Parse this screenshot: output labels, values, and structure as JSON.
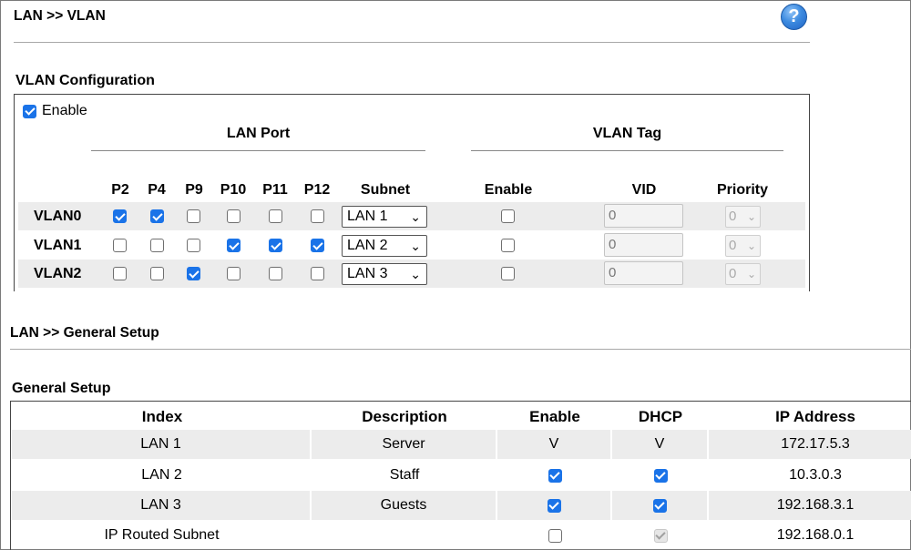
{
  "vlan_panel": {
    "breadcrumb": "LAN >> VLAN",
    "section_title": "VLAN Configuration",
    "enable_label": "Enable",
    "enable_checked": true,
    "lan_port_heading": "LAN Port",
    "vlan_tag_heading": "VLAN Tag",
    "port_headers": [
      "P2",
      "P4",
      "P9",
      "P10",
      "P11",
      "P12"
    ],
    "subnet_header": "Subnet",
    "tag_enable_header": "Enable",
    "vid_header": "VID",
    "priority_header": "Priority",
    "rows": [
      {
        "name": "VLAN0",
        "ports": [
          true,
          true,
          false,
          false,
          false,
          false
        ],
        "subnet": "LAN 1",
        "tag_enable": false,
        "vid": "0",
        "priority": "0"
      },
      {
        "name": "VLAN1",
        "ports": [
          false,
          false,
          false,
          true,
          true,
          true
        ],
        "subnet": "LAN 2",
        "tag_enable": false,
        "vid": "0",
        "priority": "0"
      },
      {
        "name": "VLAN2",
        "ports": [
          false,
          false,
          true,
          false,
          false,
          false
        ],
        "subnet": "LAN 3",
        "tag_enable": false,
        "vid": "0",
        "priority": "0"
      }
    ]
  },
  "general_panel": {
    "breadcrumb": "LAN >> General Setup",
    "section_title": "General Setup",
    "headers": {
      "index": "Index",
      "description": "Description",
      "enable": "Enable",
      "dhcp": "DHCP",
      "ip": "IP Address"
    },
    "rows": [
      {
        "index": "LAN 1",
        "description": "Server",
        "enable_text": "V",
        "dhcp_text": "V",
        "ip": "172.17.5.3"
      },
      {
        "index": "LAN 2",
        "description": "Staff",
        "enable": true,
        "dhcp": true,
        "ip": "10.3.0.3"
      },
      {
        "index": "LAN 3",
        "description": "Guests",
        "enable": true,
        "dhcp": true,
        "ip": "192.168.3.1"
      },
      {
        "index": "IP Routed Subnet",
        "description": "",
        "enable": false,
        "dhcp": "disabled-checked",
        "ip": "192.168.0.1"
      }
    ]
  },
  "help_icon": {
    "glyph": "?",
    "icon": "help-icon"
  },
  "colors": {
    "accent": "#1a73e8",
    "row_shade": "#ececec"
  }
}
